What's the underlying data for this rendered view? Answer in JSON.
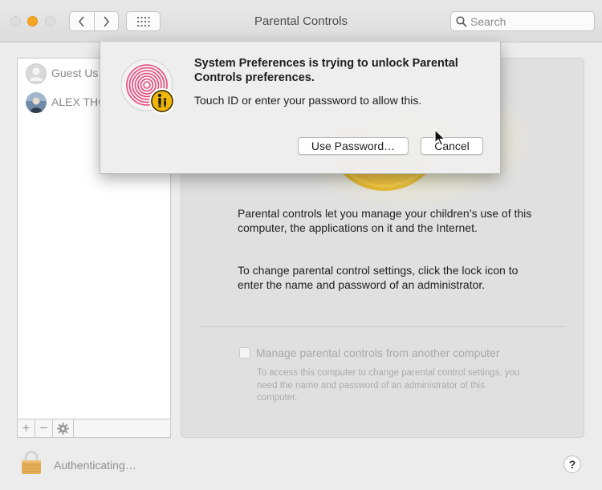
{
  "window": {
    "title": "Parental Controls",
    "search_placeholder": "Search"
  },
  "sidebar": {
    "users": [
      {
        "name": "Guest Us",
        "avatar_icon": "guest-avatar-icon"
      },
      {
        "name": "ALEX THO",
        "avatar_icon": "user-photo-avatar"
      }
    ],
    "buttons": [
      {
        "label": "+",
        "icon": "plus-icon"
      },
      {
        "label": "−",
        "icon": "minus-icon"
      },
      {
        "label": "",
        "icon": "gear-icon"
      }
    ]
  },
  "main": {
    "paragraph1": "Parental controls let you manage your children’s use of this computer, the applications on it and the Internet.",
    "paragraph2": "To change parental control settings, click the lock icon to enter the name and password of an administrator.",
    "manage_label": "Manage parental controls from another computer",
    "manage_checked": false,
    "manage_note": "To access this computer to change parental control settings, you need the name and password of an administrator of this computer."
  },
  "bottom": {
    "status_text": "Authenticating…",
    "help_label": "?"
  },
  "dialog": {
    "title": "System Preferences is trying to unlock Parental Controls preferences.",
    "message": "Touch ID or enter your password to allow this.",
    "use_password_label": "Use Password…",
    "cancel_label": "Cancel",
    "icon": "touch-id-fingerprint-icon"
  },
  "colors": {
    "fingerprint": "#e8477a",
    "badge": "#f2b705",
    "lock": "#e3ad58"
  }
}
